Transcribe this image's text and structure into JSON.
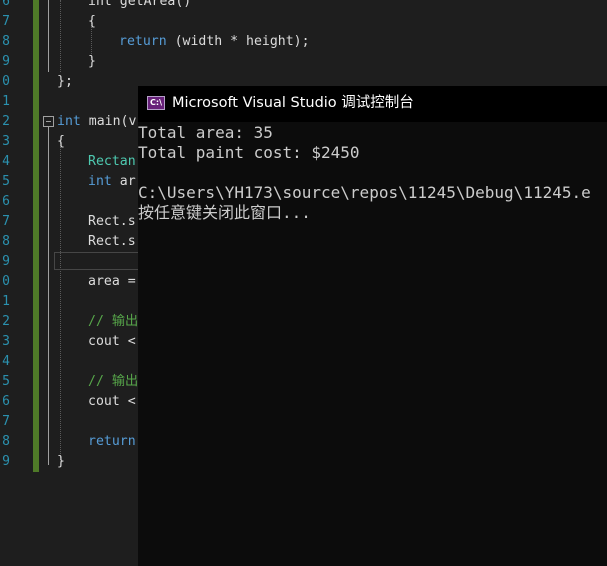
{
  "editor": {
    "line_numbers": [
      "6",
      "7",
      "8",
      "9",
      "0",
      "1",
      "2",
      "3",
      "4",
      "5",
      "6",
      "7",
      "8",
      "9",
      "0",
      "1",
      "2",
      "3",
      "4",
      "5",
      "6",
      "7",
      "8",
      "9"
    ],
    "code": {
      "getarea_partial": "int getArea()",
      "brace_open": "{",
      "return_kw": "return",
      "return_expr": " (width * height);",
      "brace_close": "}",
      "class_close": "};",
      "int_kw": "int",
      "main_sig": " main(v",
      "main_brace": "{",
      "rectangle_type": "Rectan",
      "int_kw2": "int",
      "area_decl": " ar",
      "rect_set1": "Rect.s",
      "rect_set2": "Rect.s",
      "area_assign": "area =",
      "comment1": "// 输出",
      "cout1": "cout <",
      "comment2": "// 输出",
      "cout2": "cout <",
      "return_kw2": "return",
      "main_close": "}"
    }
  },
  "console": {
    "title": "Microsoft Visual Studio 调试控制台",
    "icon_label": "C:\\",
    "lines": [
      "Total area: 35",
      "Total paint cost: $2450",
      "",
      "C:\\Users\\YH173\\source\\repos\\11245\\Debug\\11245.e",
      "按任意键关闭此窗口..."
    ]
  }
}
